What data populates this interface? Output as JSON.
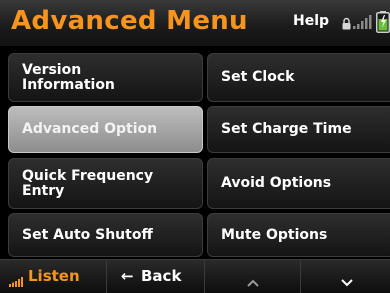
{
  "header": {
    "title": "Advanced Menu",
    "help_label": "Help",
    "status_icons": [
      "lock-icon",
      "signal-strength-icon",
      "battery-icon"
    ]
  },
  "menu": {
    "items": [
      {
        "label": "Version\nInformation",
        "selected": false
      },
      {
        "label": "Set Clock",
        "selected": false
      },
      {
        "label": "Advanced Option",
        "selected": true
      },
      {
        "label": "Set Charge Time",
        "selected": false
      },
      {
        "label": "Quick Frequency\nEntry",
        "selected": false
      },
      {
        "label": "Avoid Options",
        "selected": false
      },
      {
        "label": "Set Auto Shutoff",
        "selected": false
      },
      {
        "label": "Mute Options",
        "selected": false
      }
    ]
  },
  "footer": {
    "listen_label": "Listen",
    "back_label": "Back",
    "back_icon": "left-arrow-icon",
    "up_icon": "chevron-up-icon",
    "down_icon": "chevron-down-icon"
  },
  "colors": {
    "accent": "#f7941d",
    "selected_button": "#a8a8a8",
    "button": "#1e1e1e",
    "background": "#000000",
    "battery_fill": "#6abf3a"
  }
}
